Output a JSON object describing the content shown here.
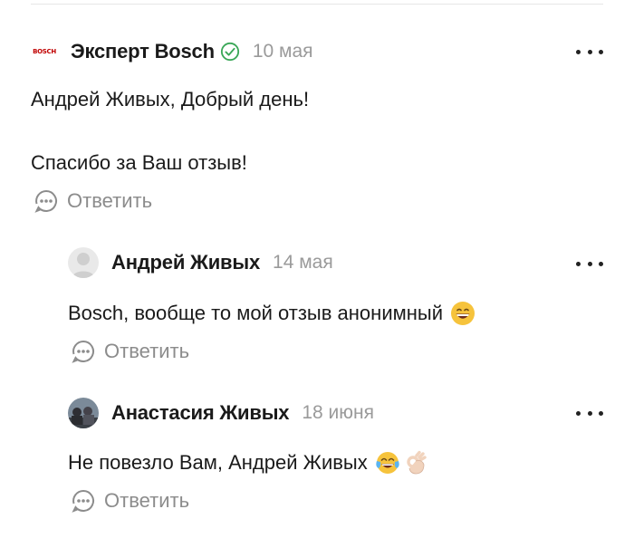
{
  "comments": [
    {
      "author": "Эксперт Bosch",
      "date": "10 мая",
      "logo_text": "BOSCH",
      "lines": [
        "Андрей Живых, Добрый день!",
        "Спасибо за Ваш отзыв!"
      ],
      "reply_label": "Ответить"
    },
    {
      "author": "Андрей Живых",
      "date": "14 мая",
      "text": "Bosch, вообще то мой отзыв анонимный",
      "emoji": "grinning-face",
      "reply_label": "Ответить"
    },
    {
      "author": "Анастасия Живых",
      "date": "18 июня",
      "text": "Не повезло Вам, Андрей Живых",
      "emoji": [
        "face-with-tears-of-joy",
        "ok-hand"
      ],
      "reply_label": "Ответить"
    }
  ],
  "colors": {
    "text": "#1a1a1a",
    "muted": "#9a9a9a",
    "verified": "#3aa757",
    "logo": "#c00000"
  }
}
